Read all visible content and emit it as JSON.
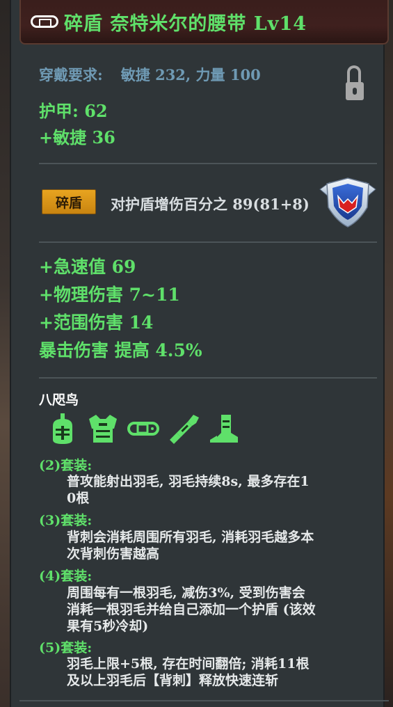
{
  "title": {
    "icon": "belt-icon",
    "text": "碎盾  奈特米尔的腰带  Lv14"
  },
  "requirements": {
    "label": "穿戴要求:",
    "value": "敏捷 232, 力量 100",
    "lock_icon": "unlocked-padlock-icon"
  },
  "base_stats": {
    "armor": "护甲:  62",
    "agility": "+敏捷  36"
  },
  "shatter": {
    "badge": "碎盾",
    "text": "对护盾增伤百分之 89(81+8)",
    "icon": "shield-emblem-icon"
  },
  "attributes": [
    "+急速值  69",
    "+物理伤害  7~11",
    "+范围伤害  14",
    "暴击伤害  提高  4.5%"
  ],
  "set": {
    "name": "八咫鸟",
    "icons": [
      "helmet-icon",
      "chest-armor-icon",
      "belt-icon",
      "gauntlet-icon",
      "boots-icon"
    ],
    "bonuses": [
      {
        "header": "(2)套装:",
        "text": "普攻能射出羽毛, 羽毛持续8s, 最多存在1\n0根"
      },
      {
        "header": "(3)套装:",
        "text": "背刺会消耗周围所有羽毛, 消耗羽毛越多本\n次背刺伤害越高"
      },
      {
        "header": "(4)套装:",
        "text": "周围每有一根羽毛, 减伤3%, 受到伤害会\n消耗一根羽毛并给自己添加一个护盾 (该效\n果有5秒冷却)"
      },
      {
        "header": "(5)套装:",
        "text": "羽毛上限+5根, 存在时间翻倍; 消耗11根\n及以上羽毛后【背刺】释放快速连斩"
      }
    ]
  },
  "colors": {
    "green": "#5fe06a",
    "blue_grey": "#6f9ab4",
    "badge_gold": "#e8a420",
    "panel_bg": "#2f3538",
    "title_bg": "#3a1e1c"
  }
}
